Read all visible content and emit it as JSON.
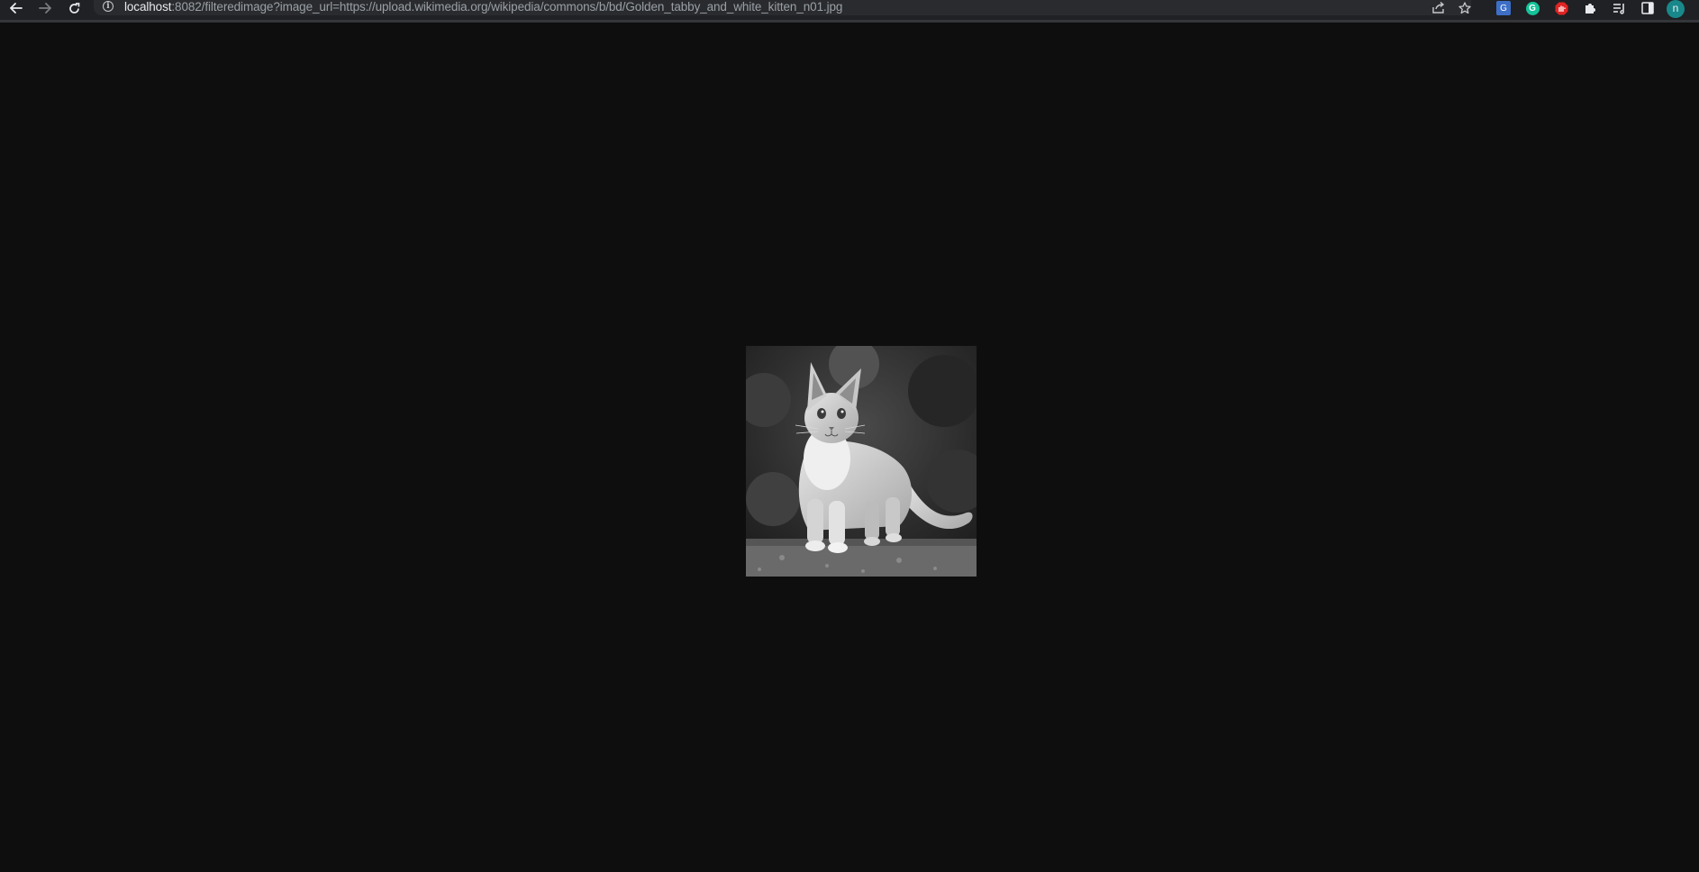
{
  "browser": {
    "url_host": "localhost",
    "url_rest": ":8082/filteredimage?image_url=https://upload.wikimedia.org/wikipedia/commons/b/bd/Golden_tabby_and_white_kitten_n01.jpg",
    "profile_initial": "n",
    "icons": {
      "back": "back-arrow-icon",
      "forward": "forward-arrow-icon",
      "reload": "reload-icon",
      "site_info": "info-icon",
      "share": "share-icon",
      "bookmark": "star-icon",
      "extensions": [
        "google-translate-icon",
        "grammarly-icon",
        "adblock-icon"
      ],
      "puzzle": "extensions-puzzle-icon",
      "reading_list": "reading-list-icon",
      "side_panel": "side-panel-icon"
    },
    "colors": {
      "toolbar": "#202124",
      "omnibox": "#2a2b2e",
      "page_background": "#0e0e0e",
      "avatar": "#19888a"
    }
  },
  "page": {
    "image": {
      "subject": "grayscale kitten photo",
      "filter": "grayscale"
    }
  }
}
